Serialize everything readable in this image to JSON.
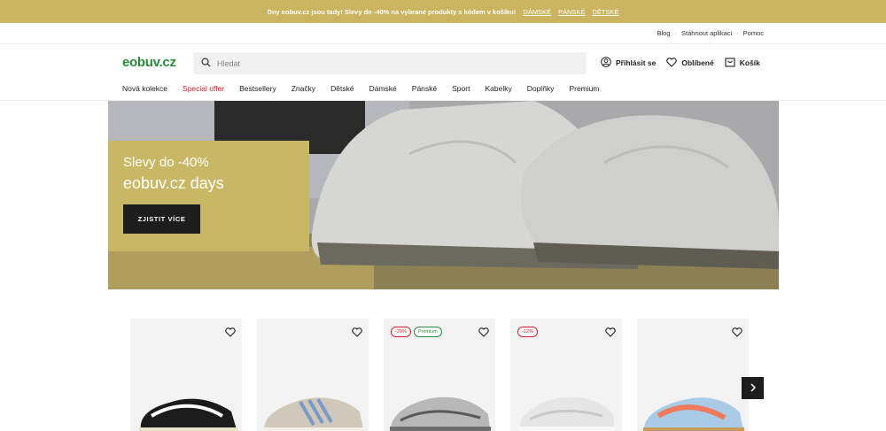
{
  "promo": {
    "text": "Dny eobuv.cz jsou tady! Slevy do -40% na vybrané produkty s kódem v košíku!",
    "links": [
      "DÁMSKÉ",
      "PÁNSKÉ",
      "DĚTSKÉ"
    ]
  },
  "utility": [
    "Blog",
    "Stáhnout aplikaci",
    "Pomoc"
  ],
  "utility_separator": "·",
  "header": {
    "logo": "eobuv.cz",
    "search_placeholder": "Hledat",
    "actions": {
      "login": "Přihlásit se",
      "favorites": "Oblíbené",
      "cart": "Košík"
    }
  },
  "nav": [
    "Nová kolekce",
    "Special offer",
    "Bestsellery",
    "Značky",
    "Dětské",
    "Dámské",
    "Pánské",
    "Sport",
    "Kabelky",
    "Doplňky",
    "Premium"
  ],
  "hero": {
    "subtitle": "Slevy do -40%",
    "title": "eobuv.cz days",
    "button": "ZJISTIT VÍCE"
  },
  "products": [
    {
      "badges": [],
      "shoe_color": "#1b1b1b",
      "accent": "#ffffff"
    },
    {
      "badges": [],
      "shoe_color": "#cfc8bb",
      "accent": "#7a9bc9"
    },
    {
      "badges": [
        {
          "type": "sale",
          "text": "-29%"
        },
        {
          "type": "prem",
          "text": "Premium"
        }
      ],
      "shoe_color": "#b8b8b8",
      "accent": "#5a5a5a"
    },
    {
      "badges": [
        {
          "type": "sale",
          "text": "-12%"
        }
      ],
      "shoe_color": "#e6e6e6",
      "accent": "#c8c8c8"
    },
    {
      "badges": [],
      "shoe_color": "#a9cbe6",
      "accent": "#f07a5e"
    }
  ],
  "colors": {
    "brand_green": "#2a8a3a",
    "promo_gold": "#cbb45f",
    "sale_red": "#d0202a",
    "dark": "#1d1d1d"
  }
}
